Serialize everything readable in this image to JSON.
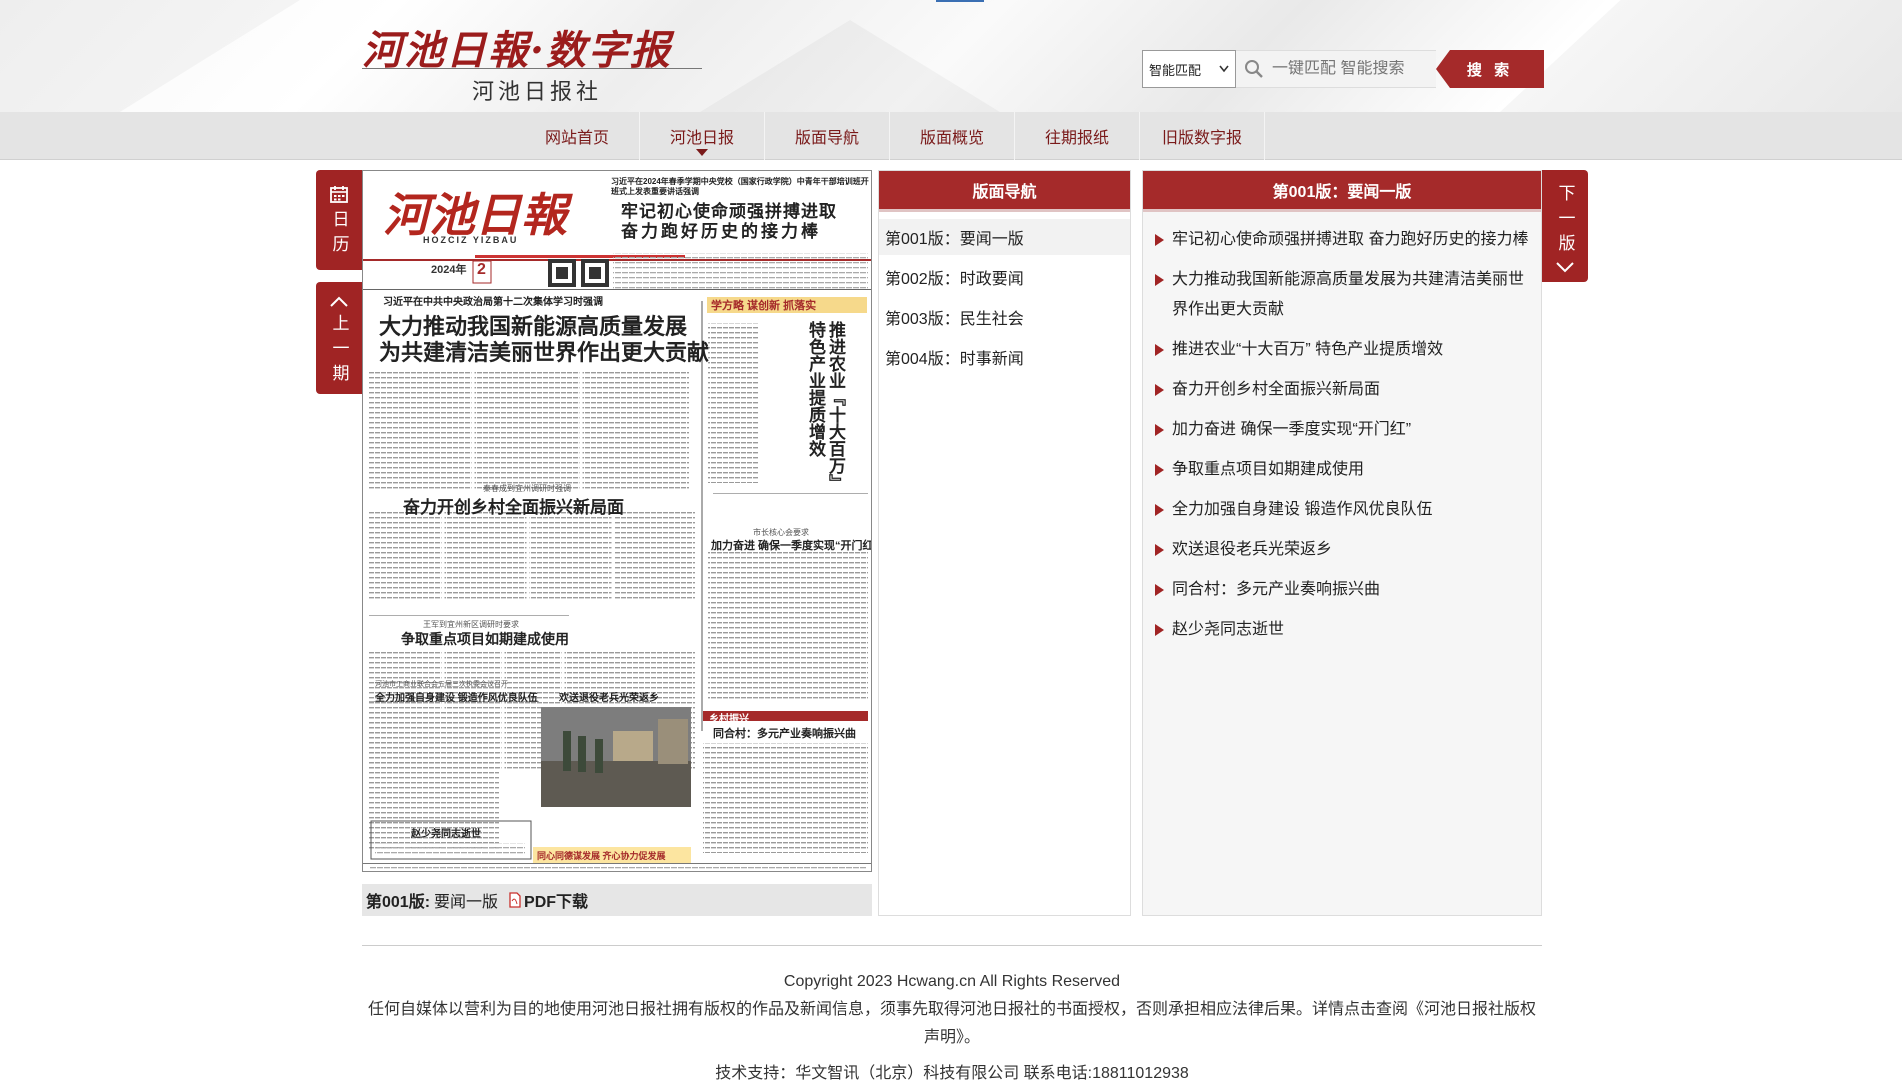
{
  "header": {
    "logo_title": "河池日報·数字报",
    "logo_subtitle": "河池日报社",
    "search": {
      "mode_selected": "智能匹配",
      "placeholder": "一键匹配 智能搜索",
      "button_label": "搜 索"
    }
  },
  "nav": {
    "items": [
      {
        "label": "网站首页"
      },
      {
        "label": "河池日报"
      },
      {
        "label": "版面导航"
      },
      {
        "label": "版面概览"
      },
      {
        "label": "往期报纸"
      },
      {
        "label": "旧版数字报"
      }
    ]
  },
  "side": {
    "calendar_label": "日历",
    "prev_label": "上一期",
    "next_label": "下一版"
  },
  "paper": {
    "masthead": "河池日報",
    "masthead_pinyin": "HOZCIZ YIZBAU",
    "date_year": "2024年",
    "date_day": "2",
    "top_small": "习近平在2024年春季学期中央党校（国家行政学院）中青年干部培训班开班式上发表重要讲话强调",
    "top_headline_1": "牢记初心使命顽强拼搏进取",
    "top_headline_2": "奋力跑好历史的接力棒",
    "lead_small": "习近平在中共中央政治局第十二次集体学习时强调",
    "lead_headline_1": "大力推动我国新能源高质量发展",
    "lead_headline_2": "为共建清洁美丽世界作出更大贡献",
    "right_banner": "学方略 谋创新 抓落实",
    "right_headline": "推进农业『十大百万』特色产业提质增效",
    "mid_small": "秦春成到宜州调研时强调",
    "mid_headline": "奋力开创乡村全面振兴新局面",
    "right_mid_small": "市长核心会要求",
    "right_mid_headline": "加力奋进 确保一季度实现“开门红”",
    "lower_small": "王军到宜州新区调研时要求",
    "lower_headline": "争取重点项目如期建成使用",
    "bottom_left_small": "河池市工商业联合会五届三次执委会议召开",
    "bottom_left_headline": "全力加强自身建设 锻造作风优良队伍",
    "photo_caption": "欢送退役老兵光荣返乡",
    "bottom_right_banner": "乡村振兴",
    "bottom_right_headline": "同合村：多元产业奏响振兴曲",
    "obit_headline": "赵少尧同志逝世",
    "footer_ad": "同心同德谋发展 齐心协力促发展"
  },
  "paper_caption": {
    "edition": "第001版:",
    "edition_name": "要闻一版",
    "pdf_label": "PDF下载"
  },
  "edition_nav": {
    "title": "版面导航",
    "items": [
      {
        "label": "第001版：要闻一版"
      },
      {
        "label": "第002版：时政要闻"
      },
      {
        "label": "第003版：民生社会"
      },
      {
        "label": "第004版：时事新闻"
      }
    ]
  },
  "articles": {
    "title": "第001版：要闻一版",
    "items": [
      {
        "label": "牢记初心使命顽强拼搏进取 奋力跑好历史的接力棒"
      },
      {
        "label": "大力推动我国新能源高质量发展为共建清洁美丽世界作出更大贡献"
      },
      {
        "label": "推进农业“十大百万” 特色产业提质增效"
      },
      {
        "label": "奋力开创乡村全面振兴新局面"
      },
      {
        "label": "加力奋进 确保一季度实现“开门红”"
      },
      {
        "label": "争取重点项目如期建成使用"
      },
      {
        "label": "全力加强自身建设 锻造作风优良队伍"
      },
      {
        "label": "欢送退役老兵光荣返乡"
      },
      {
        "label": "同合村：多元产业奏响振兴曲"
      },
      {
        "label": "赵少尧同志逝世"
      }
    ]
  },
  "footer": {
    "copyright": "Copyright 2023 Hcwang.cn All Rights Reserved",
    "notice": "任何自媒体以营利为目的地使用河池日报社拥有版权的作品及新闻信息，须事先取得河池日报社的书面授权，否则承担相应法律后果。详情点击查阅《河池日报社版权声明》。",
    "support": "技术支持：华文智讯（北京）科技有限公司 联系电话:18811012938"
  },
  "colors": {
    "brand_red": "#a52a2a",
    "nav_bg": "#e4e4e4",
    "nav_text": "#7a1a1a"
  },
  "icons": [
    "calendar-icon",
    "chevron-up-icon",
    "chevron-down-icon",
    "search-icon",
    "pdf-icon",
    "triangle-bullet-icon",
    "dropdown-caret-icon"
  ]
}
